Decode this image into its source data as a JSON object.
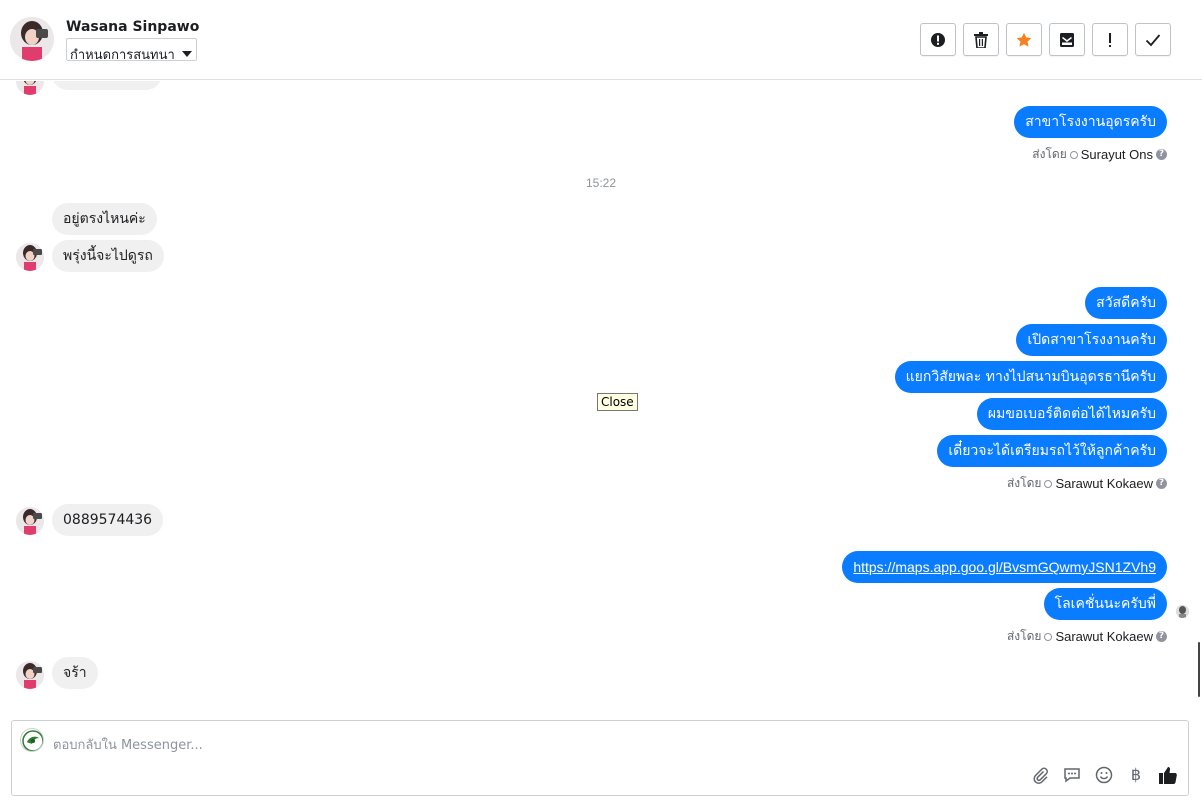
{
  "header": {
    "contact_name": "Wasana Sinpawo",
    "label_select_value": "กำหนดการสนทนา",
    "toolbar": [
      {
        "name": "mark-spam-button",
        "icon": "alert-circle-icon"
      },
      {
        "name": "delete-button",
        "icon": "trash-icon"
      },
      {
        "name": "star-button",
        "icon": "star-icon"
      },
      {
        "name": "mark-unread-button",
        "icon": "envelope-icon"
      },
      {
        "name": "follow-up-button",
        "icon": "exclamation-icon"
      },
      {
        "name": "mark-done-button",
        "icon": "check-icon"
      }
    ]
  },
  "messages": {
    "out_1": "สาขาโรงงานอุดรครับ",
    "sent_by_1_label": "ส่งโดย",
    "sent_by_1_name": "Surayut Ons",
    "time_sep": "15:22",
    "in_1": "อยู่ตรงไหนค่ะ",
    "in_2": "พรุ่งนี้จะไปดูรถ",
    "out_2": "สวัสดีครับ",
    "out_3": "เปิดสาขาโรงงานครับ",
    "out_4": "แยกวิสัยพละ ทางไปสนามบินอุดรธานีครับ",
    "out_5": "ผมขอเบอร์ติดต่อได้ไหมครับ",
    "out_6": "เดี๋ยวจะได้เตรียมรถไว้ให้ลูกค้าครับ",
    "sent_by_2_label": "ส่งโดย",
    "sent_by_2_name": "Sarawut Kokaew",
    "in_3": "0889574436",
    "out_link": "https://maps.app.goo.gl/BvsmGQwmyJSN1ZVh9",
    "out_7": "โลเคชั่นนะครับพี่",
    "sent_by_3_label": "ส่งโดย",
    "sent_by_3_name": "Sarawut Kokaew",
    "in_4": "จร้า",
    "help_glyph": "?"
  },
  "tooltip": "Close",
  "composer": {
    "placeholder": "ตอบกลับใน Messenger...",
    "actions": [
      "paperclip-icon",
      "saved-reply-icon",
      "emoji-icon",
      "baht-icon",
      "thumbs-up-icon"
    ],
    "baht_symbol": "฿"
  },
  "colors": {
    "outgoing_bubble": "#0a7cff",
    "incoming_bubble": "#f1f0f0",
    "star": "#f5821f"
  }
}
